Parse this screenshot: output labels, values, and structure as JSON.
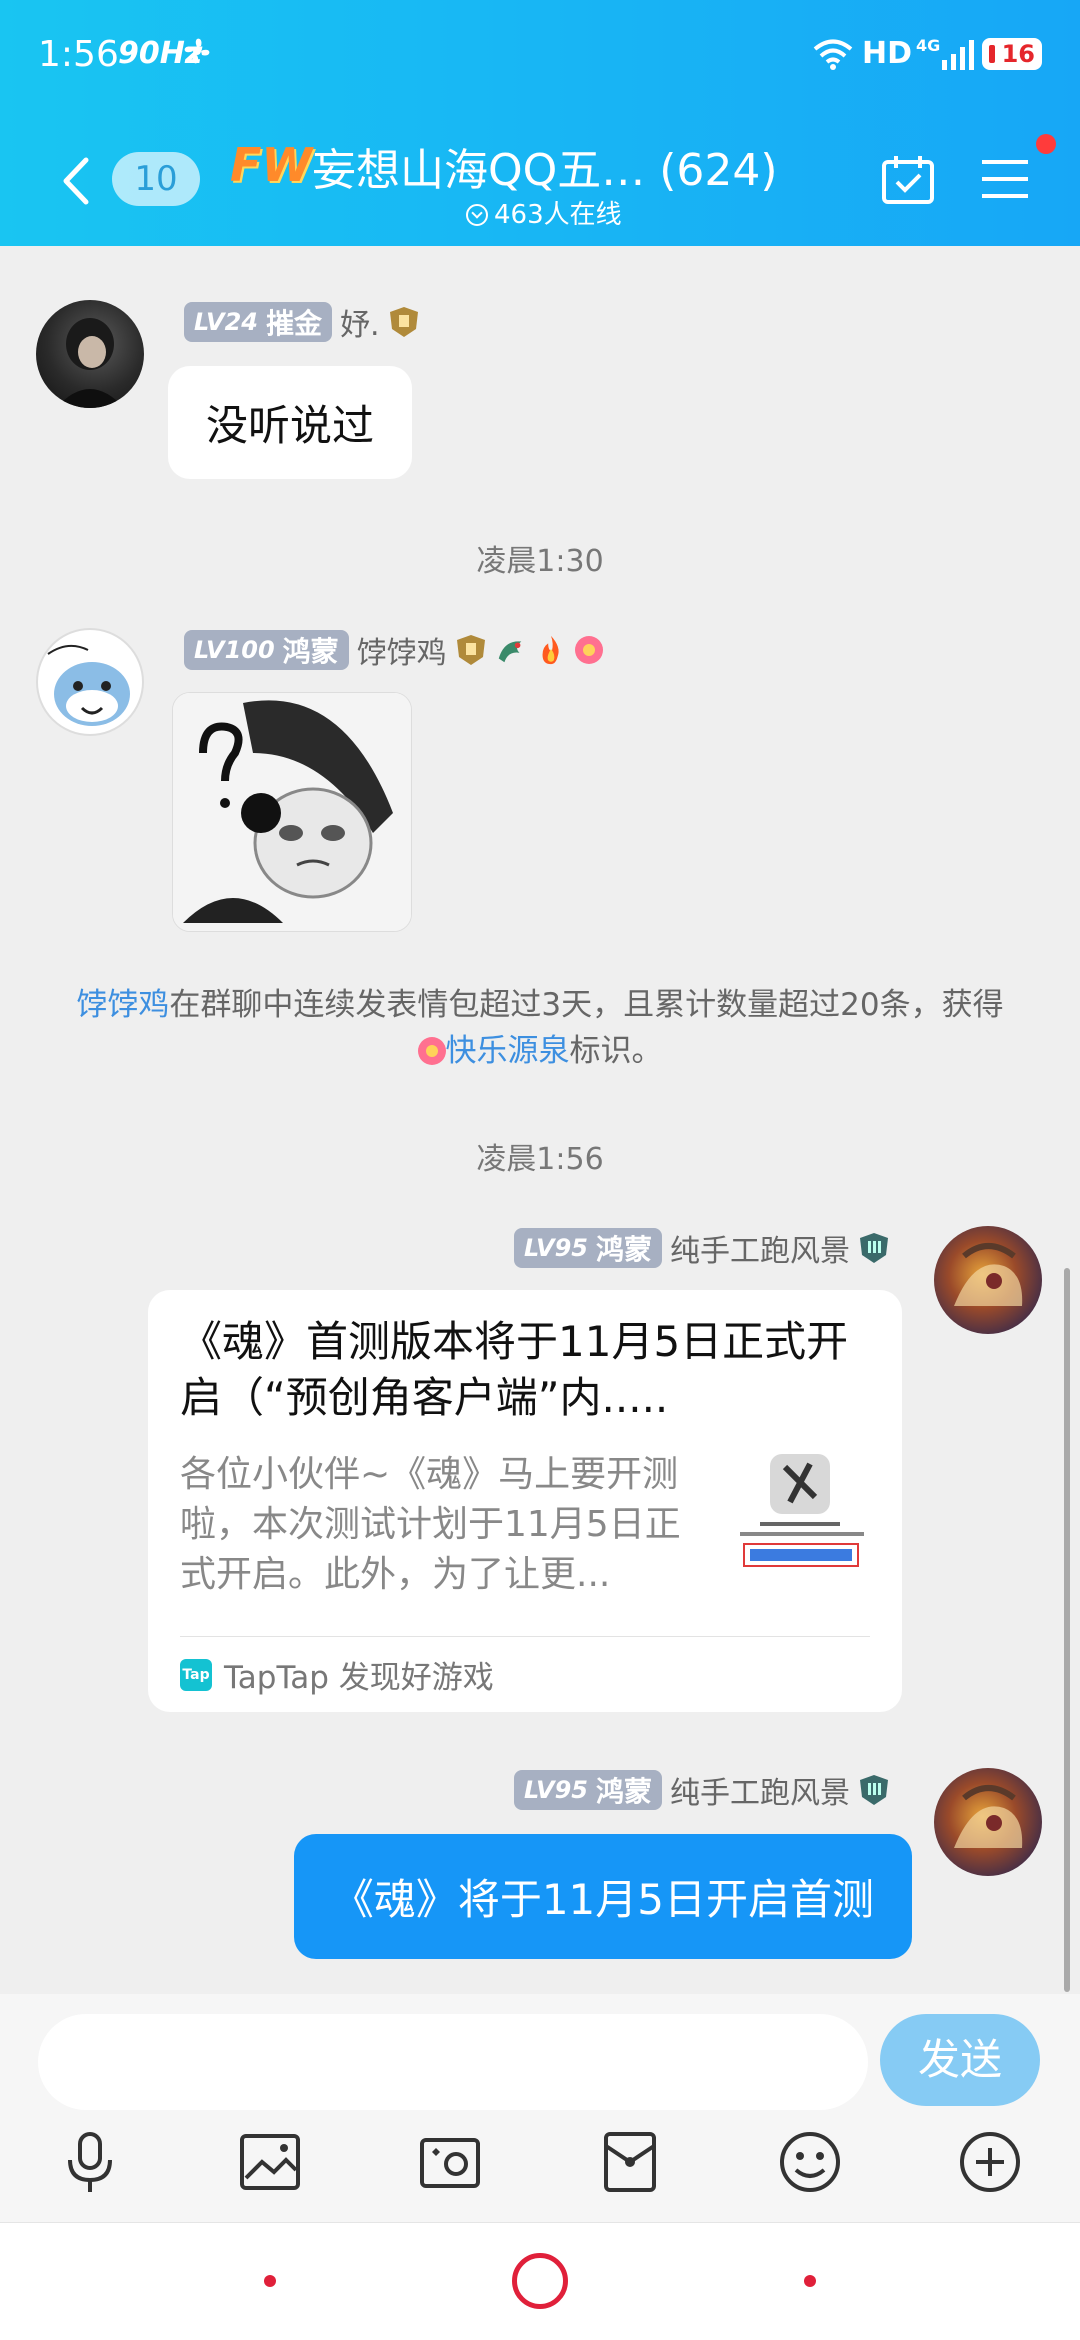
{
  "status_bar": {
    "time": "1:56",
    "refresh": "90Hz",
    "network": "HD",
    "net_type": "4G",
    "battery": "16"
  },
  "header": {
    "unread_count": "10",
    "logo": "FW",
    "group_title": "妄想山海QQ五… (624)",
    "online": "463人在线"
  },
  "messages": [
    {
      "level": "LV24",
      "title": "摧金",
      "nickname": "妤.",
      "text": "没听说过"
    },
    {
      "level": "LV100",
      "title": "鸿蒙",
      "nickname": "饽饽鸡"
    },
    {
      "level": "LV95",
      "title": "鸿蒙",
      "nickname": "纯手工跑风景",
      "card": {
        "title": "《魂》首测版本将于11月5日正式开启（“预创角客户端”内.....",
        "desc": "各位小伙伴~《魂》马上要开测啦，本次测试计划于11月5日正式开启。此外，为了让更...",
        "source": "TapTap 发现好游戏",
        "source_icon": "Tap"
      }
    },
    {
      "level": "LV95",
      "title": "鸿蒙",
      "nickname": "纯手工跑风景",
      "text": "《魂》将于11月5日开启首测"
    }
  ],
  "times": [
    "凌晨1:30",
    "凌晨1:56"
  ],
  "notice": {
    "user": "饽饽鸡",
    "text": "在群聊中连续发表情包超过3天，且累计数量超过20条，获得",
    "badge": "快乐源泉",
    "suffix": "标识。"
  },
  "input": {
    "value": "",
    "send_label": "发送"
  },
  "colors": {
    "header_start": "#19c5f2",
    "header_end": "#17a7f6",
    "bubble_self": "#1696f7",
    "link": "#3d8fe0"
  }
}
